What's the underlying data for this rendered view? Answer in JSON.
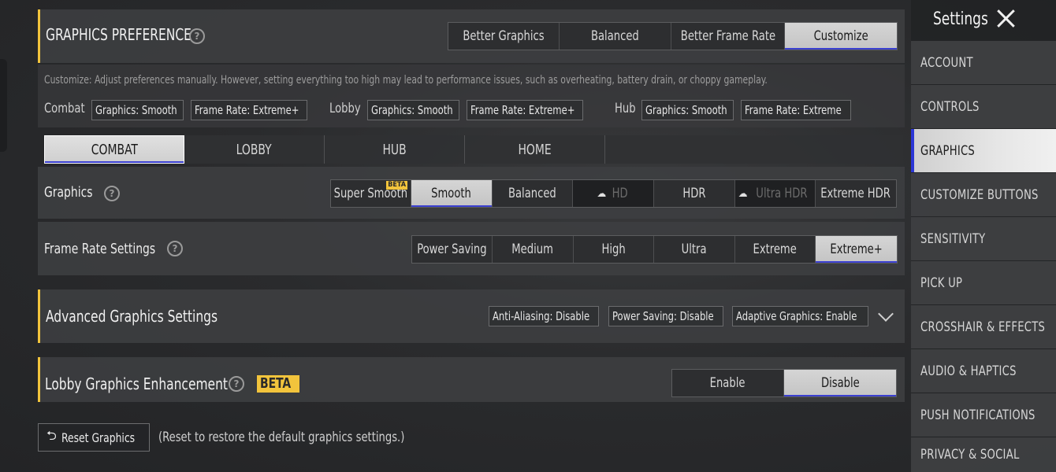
{
  "graphics_preference": {
    "title": "GRAPHICS PREFERENCE",
    "options": [
      "Better Graphics",
      "Balanced",
      "Better Frame Rate",
      "Customize"
    ],
    "selected": "Customize",
    "description": "Customize: Adjust preferences manually. However, setting everything too high may lead to performance issues, such as overheating, battery drain, or choppy gameplay.",
    "summary": {
      "combat_label": "Combat",
      "combat_graphics": "Graphics: Smooth",
      "combat_frame": "Frame Rate: Extreme+",
      "lobby_label": "Lobby",
      "lobby_graphics": "Graphics: Smooth",
      "lobby_frame": "Frame Rate: Extreme+",
      "hub_label": "Hub",
      "hub_graphics": "Graphics: Smooth",
      "hub_frame": "Frame Rate: Extreme"
    }
  },
  "mode_tabs": [
    "COMBAT",
    "LOBBY",
    "HUB",
    "HOME"
  ],
  "mode_tab_selected": "COMBAT",
  "graphics": {
    "label": "Graphics",
    "options": [
      "Super Smooth",
      "Smooth",
      "Balanced",
      "HD",
      "HDR",
      "Ultra HDR",
      "Extreme HDR"
    ],
    "selected": "Smooth",
    "beta_tag": "BETA"
  },
  "frame_rate": {
    "label": "Frame Rate Settings",
    "options": [
      "Power Saving",
      "Medium",
      "High",
      "Ultra",
      "Extreme",
      "Extreme+"
    ],
    "selected": "Extreme+"
  },
  "advanced": {
    "title": "Advanced Graphics Settings",
    "chips": [
      "Anti-Aliasing: Disable",
      "Power Saving: Disable",
      "Adaptive Graphics: Enable"
    ]
  },
  "lobby_enhancement": {
    "title": "Lobby Graphics Enhancement",
    "badge": "BETA",
    "options": [
      "Enable",
      "Disable"
    ],
    "selected": "Disable"
  },
  "reset": {
    "button_label": "Reset Graphics",
    "hint": "(Reset to restore the default graphics settings.)"
  },
  "sidebar": {
    "title": "Settings",
    "items": [
      "ACCOUNT",
      "CONTROLS",
      "GRAPHICS",
      "CUSTOMIZE BUTTONS",
      "SENSITIVITY",
      "PICK UP",
      "CROSSHAIR & EFFECTS",
      "AUDIO & HAPTICS",
      "PUSH NOTIFICATIONS",
      "PRIVACY & SOCIAL"
    ],
    "selected": "GRAPHICS"
  },
  "colors": {
    "accent": "#f2c43c",
    "selection_underline": "#3a3fd0",
    "sidebar_selected_bar": "#2b36d6"
  }
}
